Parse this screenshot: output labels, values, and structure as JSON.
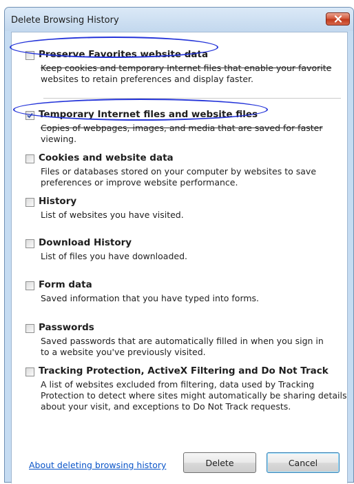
{
  "dialog": {
    "title": "Delete Browsing History",
    "close_icon": "close-icon",
    "accent_color": "#c0391b"
  },
  "options": [
    {
      "key": "preserve_favorites",
      "label": "Preserve Favorites website data",
      "checked": false,
      "description_line1": "Keep cookies and temporary Internet files that enable your favorite",
      "description_line2": "websites to retain preferences and display faster."
    },
    {
      "key": "temporary_files",
      "label": "Temporary Internet files and website files",
      "checked": true,
      "description_line1": "Copies of webpages, images, and media that are saved for faster",
      "description_line2": "viewing."
    },
    {
      "key": "cookies",
      "label": "Cookies and website data",
      "checked": false,
      "description_line1": "Files or databases stored on your computer by websites to save",
      "description_line2": "preferences or improve website performance."
    },
    {
      "key": "history",
      "label": "History",
      "checked": false,
      "description_line1": "List of websites you have visited.",
      "description_line2": ""
    },
    {
      "key": "download_history",
      "label": "Download History",
      "checked": false,
      "description_line1": "List of files you have downloaded.",
      "description_line2": ""
    },
    {
      "key": "form_data",
      "label": "Form data",
      "checked": false,
      "description_line1": "Saved information that you have typed into forms.",
      "description_line2": ""
    },
    {
      "key": "passwords",
      "label": "Passwords",
      "checked": false,
      "description_line1": "Saved passwords that are automatically filled in when you sign in",
      "description_line2": "to a website you've previously visited."
    },
    {
      "key": "tracking_protection",
      "label": "Tracking Protection, ActiveX Filtering and Do Not Track",
      "checked": false,
      "description_line1": "A list of websites excluded from filtering, data used by Tracking",
      "description_line2": "Protection to detect where sites might automatically be sharing details",
      "description_line3": "about your visit, and exceptions to Do Not Track requests."
    }
  ],
  "footer": {
    "link_label": "About deleting browsing history",
    "delete_label": "Delete",
    "cancel_label": "Cancel"
  }
}
